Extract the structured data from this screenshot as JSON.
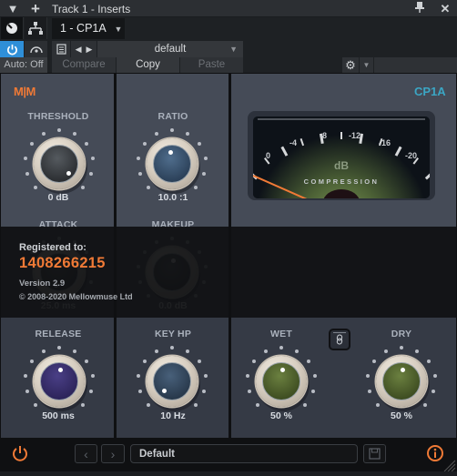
{
  "window": {
    "title": "Track 1 - Inserts",
    "slot_name": "1 - CP1A",
    "auto_label": "Auto: Off",
    "preset_name": "default",
    "compare_label": "Compare",
    "copy_label": "Copy",
    "paste_label": "Paste"
  },
  "plugin": {
    "brand_logo": "M|M",
    "product_name": "CP1A",
    "accent_color": "#f07a36",
    "product_color": "#3ba6c4",
    "knobs": [
      {
        "label": "THRESHOLD",
        "value": "0 dB",
        "color": "dark"
      },
      {
        "label": "RATIO",
        "value": "10.0 :1",
        "color": "blue"
      },
      {
        "label": "ATTACK",
        "value": "25.0 ms",
        "color": "dark"
      },
      {
        "label": "MAKEUP",
        "value": "0.0 dB",
        "color": "dark"
      },
      {
        "label": "RELEASE",
        "value": "500 ms",
        "color": "purple"
      },
      {
        "label": "KEY HP",
        "value": "10 Hz",
        "color": "steel"
      },
      {
        "label": "WET",
        "value": "50 %",
        "color": "green"
      },
      {
        "label": "DRY",
        "value": "50 %",
        "color": "green"
      }
    ],
    "meter": {
      "scale": [
        "0",
        "-4",
        "-8",
        "-12",
        "-16",
        "-20"
      ],
      "unit": "dB",
      "caption": "COMPRESSION",
      "reading_db": 0
    },
    "registration": {
      "heading": "Registered to:",
      "id": "1408266215",
      "version": "Version 2.9",
      "copyright": "© 2008-2020 Mellowmuse Ltd"
    },
    "footer": {
      "preset_name": "Default"
    }
  }
}
